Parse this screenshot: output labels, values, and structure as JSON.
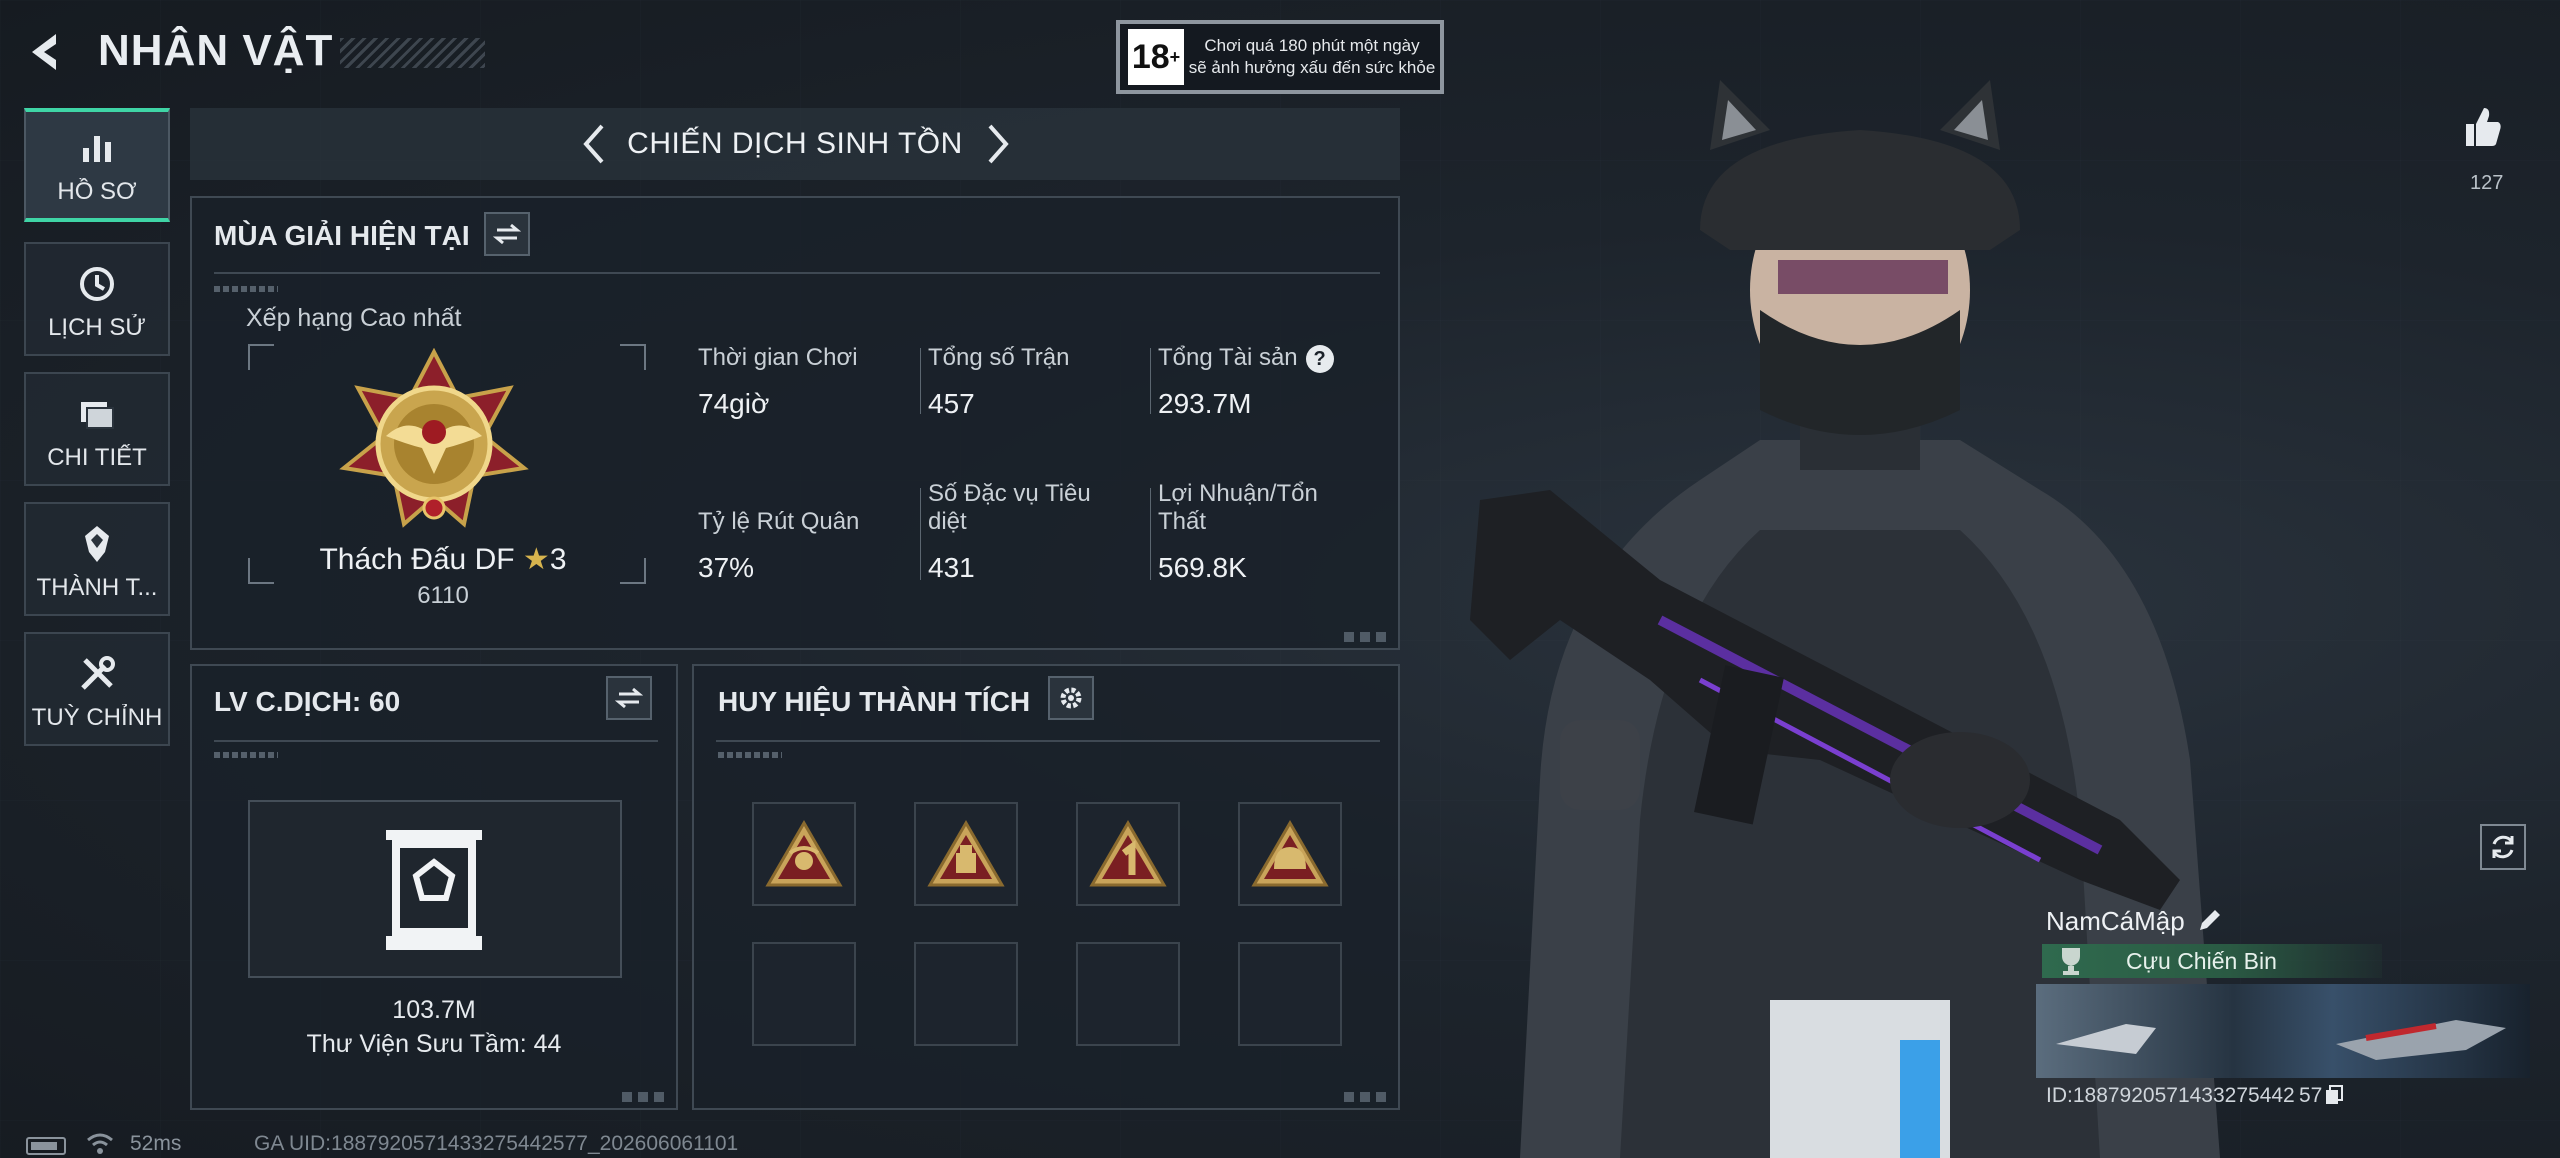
{
  "header": {
    "title": "NHÂN VẬT"
  },
  "age_notice": {
    "badge": "18",
    "badge_plus": "+",
    "line1": "Chơi quá 180 phút một ngày",
    "line2": "sẽ ảnh hưởng xấu đến sức khỏe"
  },
  "nav": [
    {
      "label": "HỒ SƠ",
      "icon": "bar-chart-icon",
      "active": true
    },
    {
      "label": "LỊCH SỬ",
      "icon": "history-icon"
    },
    {
      "label": "CHI TIẾT",
      "icon": "folder-icon"
    },
    {
      "label": "THÀNH T...",
      "icon": "achievement-icon"
    },
    {
      "label": "TUỲ CHỈNH",
      "icon": "tools-icon"
    }
  ],
  "mode": {
    "title": "CHIẾN DỊCH SINH TỒN"
  },
  "season": {
    "heading": "MÙA GIẢI HIỆN TẠI",
    "best_rank_label": "Xếp hạng Cao nhất",
    "rank_name": "Thách Đấu DF",
    "rank_stars": "3",
    "rank_points": "6110",
    "stats": [
      {
        "label": "Thời gian Chơi",
        "value": "74giờ"
      },
      {
        "label": "Tổng số Trận",
        "value": "457"
      },
      {
        "label": "Tổng Tài sản",
        "value": "293.7M",
        "help": "?"
      },
      {
        "label": "Tỷ lệ Rút Quân",
        "value": "37%"
      },
      {
        "label": "Số Đặc vụ Tiêu diệt",
        "value": "431"
      },
      {
        "label": "Lợi Nhuận/Tổn Thất",
        "value": "569.8K"
      }
    ]
  },
  "level": {
    "heading": "LV C.DỊCH: 60",
    "value": "103.7M",
    "collection": "Thư Viện Sưu Tầm: 44"
  },
  "badges": {
    "heading": "HUY HIỆU THÀNH TÍCH",
    "filled": 4,
    "slots": 8
  },
  "profile": {
    "likes": "127",
    "name": "NamCáMập",
    "rank_title": "Cựu Chiến Bin",
    "uid": "ID:1887920571433275442 57"
  },
  "status": {
    "ping": "52ms",
    "ga_uid": "GA UID:1887920571433275442577_202606061101"
  },
  "colors": {
    "accent": "#3fd5a6",
    "panel_border": "#3f4953",
    "bg": "#1b2129"
  }
}
